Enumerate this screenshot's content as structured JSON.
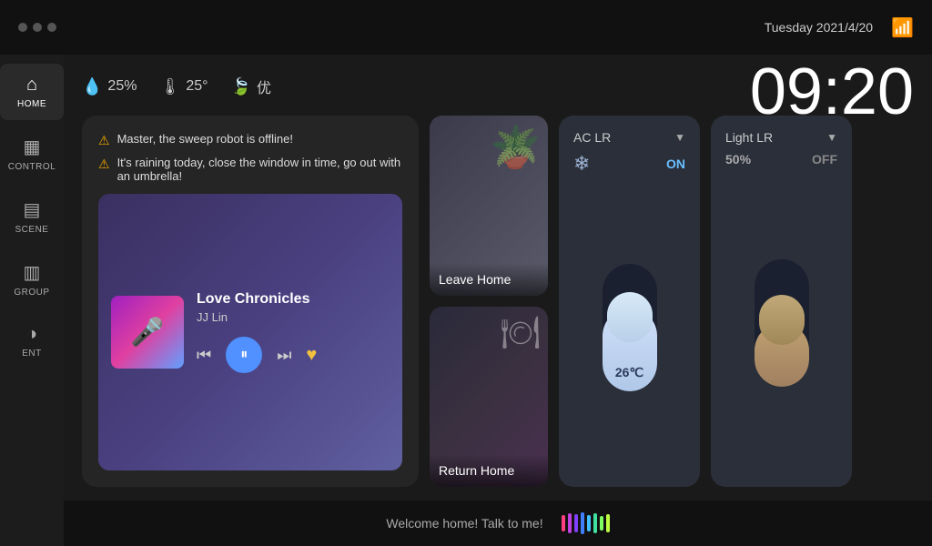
{
  "topbar": {
    "dots": [
      "dot1",
      "dot2",
      "dot3"
    ],
    "date": "Tuesday   2021/4/20",
    "wifi_label": "wifi"
  },
  "clock": {
    "time": "09:20"
  },
  "status": {
    "humidity_icon": "💧",
    "humidity_value": "25%",
    "temp_icon": "🌡",
    "temp_value": "25°",
    "leaf_icon": "🍃",
    "air_value": "优"
  },
  "sidebar": {
    "items": [
      {
        "id": "home",
        "label": "HOME",
        "icon": "⌂",
        "active": true
      },
      {
        "id": "control",
        "label": "CONTROL",
        "icon": "⊞",
        "active": false
      },
      {
        "id": "scene",
        "label": "SCENE",
        "icon": "⊟",
        "active": false
      },
      {
        "id": "group",
        "label": "GROUP",
        "icon": "⊠",
        "active": false
      },
      {
        "id": "ent",
        "label": "ENT",
        "icon": "◑",
        "active": false
      }
    ]
  },
  "notifications": [
    {
      "text": "Master, the sweep robot is offline!"
    },
    {
      "text": "It's raining today, close the window in time, go out with an umbrella!"
    }
  ],
  "music": {
    "title": "Love Chronicles",
    "artist": "JJ Lin",
    "prev_label": "⏮",
    "play_label": "⏸",
    "next_label": "⏭",
    "heart": "♥"
  },
  "scenes": [
    {
      "id": "leave-home",
      "label": "Leave Home",
      "deco": "🪴"
    },
    {
      "id": "return-home",
      "label": "Return Home",
      "deco": "🍽"
    }
  ],
  "ac": {
    "title": "AC LR",
    "status": "ON",
    "icon": "❄",
    "temp": "26℃",
    "chevron": "▼"
  },
  "light": {
    "title": "Light LR",
    "percent": "50%",
    "status": "OFF",
    "chevron": "▼"
  },
  "bottom": {
    "text": "Welcome home! Talk to me!",
    "wave_colors": [
      "#ff4080",
      "#8040ff",
      "#4080ff",
      "#40c0ff",
      "#40ffb0",
      "#80ff40",
      "#ffff40"
    ]
  }
}
